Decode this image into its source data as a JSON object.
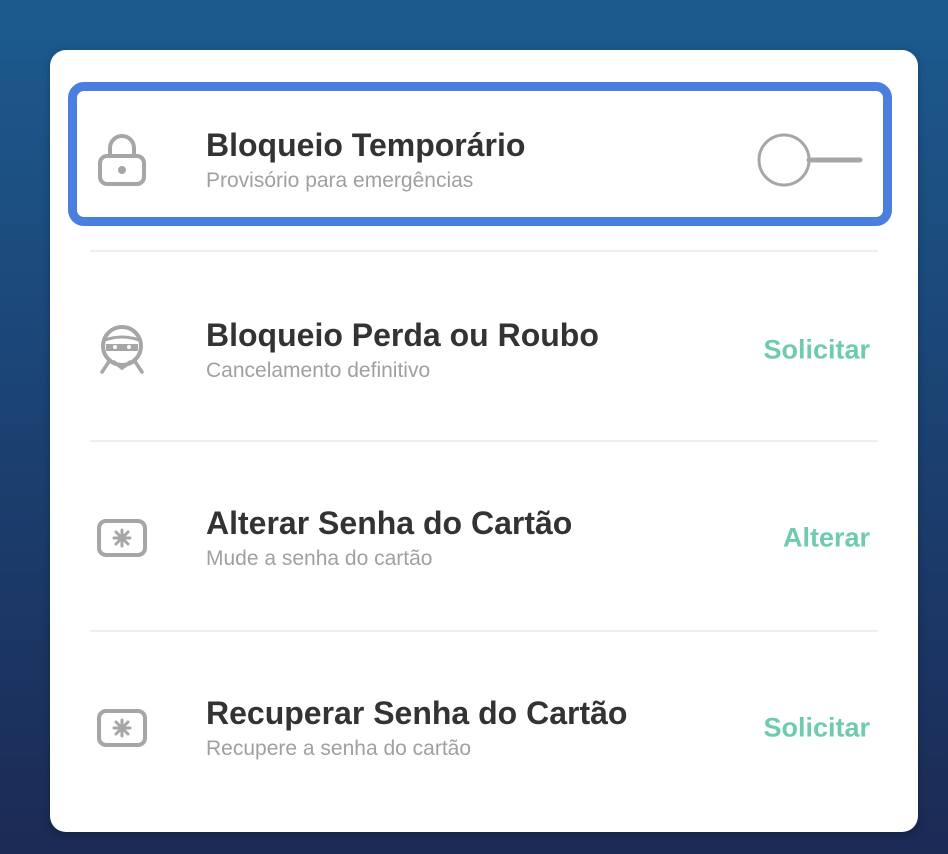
{
  "rows": [
    {
      "title": "Bloqueio Temporário",
      "subtitle": "Provisório para emergências",
      "icon": "lock-icon",
      "control": "toggle",
      "toggle_state": "off"
    },
    {
      "title": "Bloqueio Perda ou Roubo",
      "subtitle": "Cancelamento definitivo",
      "icon": "thief-icon",
      "action": "Solicitar"
    },
    {
      "title": "Alterar Senha do Cartão",
      "subtitle": "Mude a senha do cartão",
      "icon": "card-password-icon",
      "action": "Alterar"
    },
    {
      "title": "Recuperar Senha do Cartão",
      "subtitle": "Recupere a senha do cartão",
      "icon": "card-password-icon",
      "action": "Solicitar"
    }
  ],
  "colors": {
    "accent": "#6fcbb0",
    "highlight": "#4a7fe0",
    "title": "#333333",
    "subtitle": "#a0a0a0",
    "icon": "#a6a6a6"
  }
}
